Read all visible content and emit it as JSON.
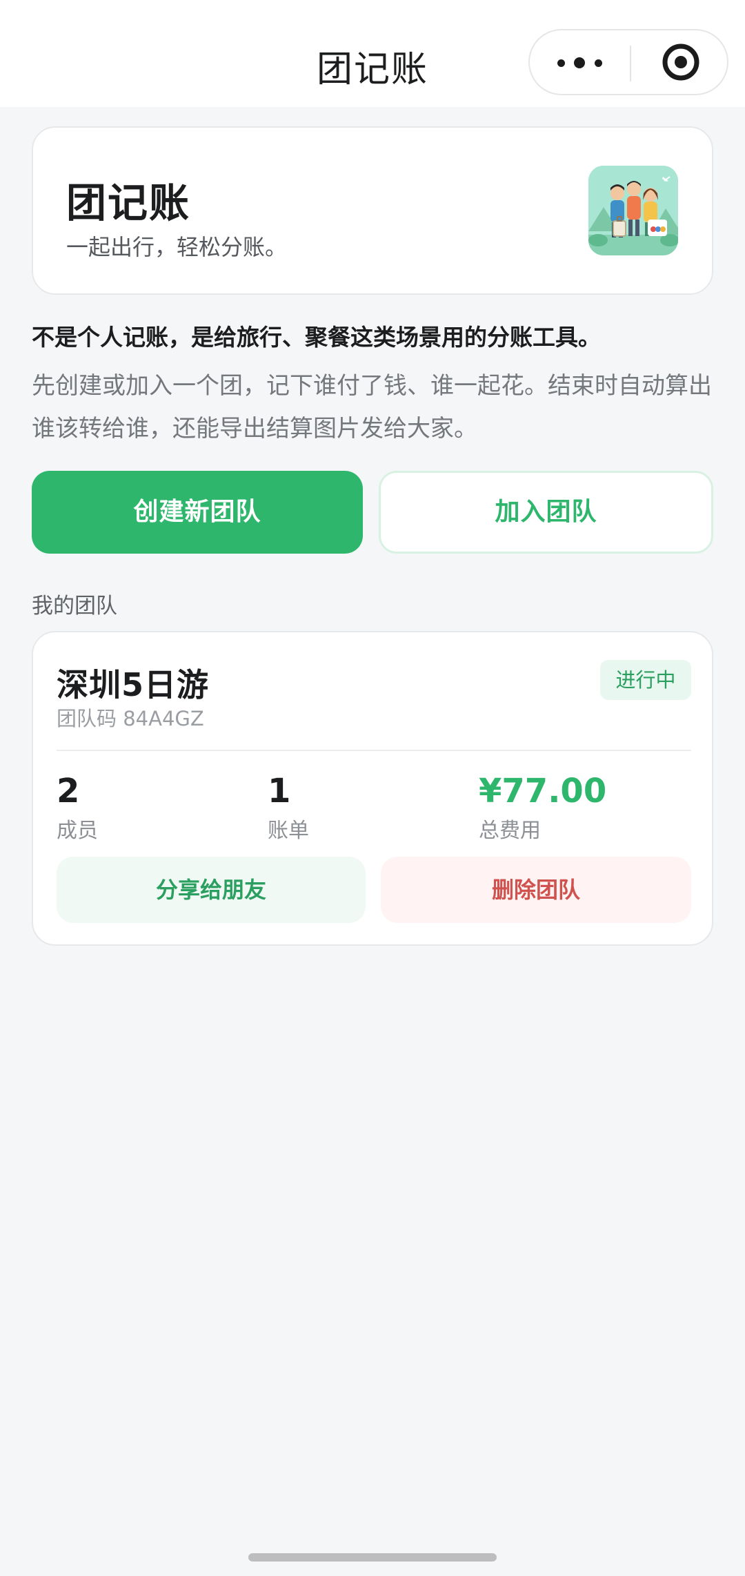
{
  "navbar": {
    "title": "团记账",
    "more_icon": "more-dots-icon",
    "close_icon": "target-circle-icon"
  },
  "hero": {
    "title": "团记账",
    "subtitle": "一起出行，轻松分账。",
    "logo_icon": "travel-group-illustration"
  },
  "intro": {
    "headline": "不是个人记账，是给旅行、聚餐这类场景用的分账工具。",
    "description": "先创建或加入一个团，记下谁付了钱、谁一起花。结束时自动算出谁该转给谁，还能导出结算图片发给大家。"
  },
  "actions": {
    "create_label": "创建新团队",
    "join_label": "加入团队"
  },
  "section": {
    "my_teams_label": "我的团队"
  },
  "teams": [
    {
      "name": "深圳5日游",
      "code": "团队码 84A4GZ",
      "status": "进行中",
      "members_value": "2",
      "members_label": "成员",
      "bills_value": "1",
      "bills_label": "账单",
      "total_value": "¥77.00",
      "total_label": "总费用",
      "share_label": "分享给朋友",
      "delete_label": "删除团队"
    }
  ],
  "colors": {
    "accent": "#2db66c",
    "danger": "#d0524e",
    "background": "#f5f6f8"
  }
}
